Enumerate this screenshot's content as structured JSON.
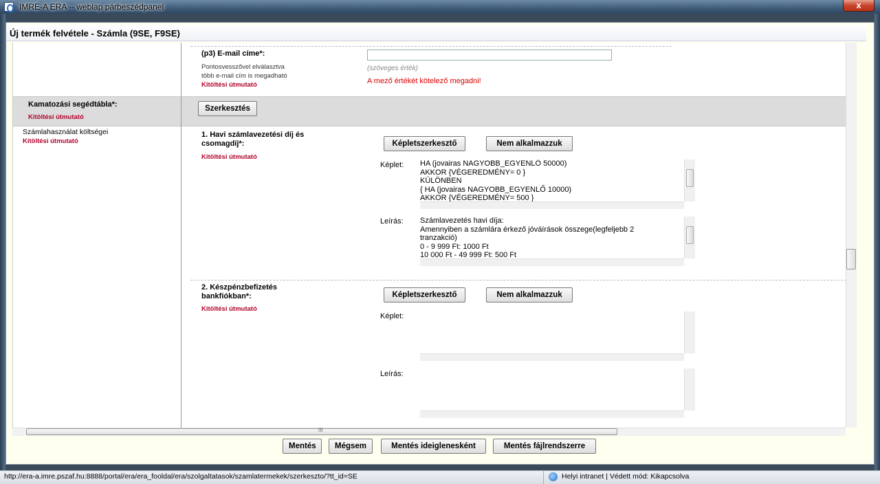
{
  "window": {
    "title": "IMRE-A ERA -- weblap párbeszédpanel",
    "close_glyph": "x"
  },
  "dialog": {
    "title": "Új termék felvétele - Számla (9SE, F9SE)"
  },
  "email_section": {
    "label": "(p3) E-mail címe*:",
    "note_line1": "Pontosvesszővel elválasztva",
    "note_line2": "több e-mail cím is megadható",
    "guide_link": "Kitöltési útmutató",
    "input_value": "",
    "value_hint": "(szöveges érték)",
    "error": "A mező értékét kötelező megadni!"
  },
  "interest_section": {
    "label": "Kamatozási segédtábla*:",
    "guide_link": "Kitöltési útmutató",
    "edit_button": "Szerkesztés"
  },
  "usage_section": {
    "label": "Számlahasználat költségei",
    "guide_link": "Kitöltési útmutató",
    "fees": [
      {
        "title_line1": "1. Havi számlavezetési díj és",
        "title_line2": "csomagdíj*:",
        "guide_link": "Kitöltési útmutató",
        "formula_editor_button": "Képletszerkesztő",
        "not_applied_button": "Nem alkalmazzuk",
        "formula_label": "Képlet:",
        "formula_text": "HA (jovairas NAGYOBB_EGYENLŐ 50000)\nAKKOR {VÉGEREDMÉNY= 0 }\nKÜLÖNBEN\n{ HA (jovairas NAGYOBB_EGYENLŐ 10000)\nAKKOR {VÉGEREDMÉNY= 500 }",
        "description_label": "Leírás:",
        "description_text": "Számlavezetés havi díja:\nAmennyiben a számlára érkező jóváírások összege(legfeljebb 2\ntranzakció)\n0 - 9 999 Ft: 1000 Ft\n10 000 Ft - 49 999 Ft: 500 Ft"
      },
      {
        "title_line1": "2. Készpénzbefizetés",
        "title_line2": "bankfiókban*:",
        "guide_link": "Kitöltési útmutató",
        "formula_editor_button": "Képletszerkesztő",
        "not_applied_button": "Nem alkalmazzuk",
        "formula_label": "Képlet:",
        "formula_text": "",
        "description_label": "Leírás:",
        "description_text": ""
      }
    ]
  },
  "footer": {
    "save": "Mentés",
    "cancel": "Mégsem",
    "save_temp": "Mentés ideiglenesként",
    "save_fs": "Mentés fájlrendszerre"
  },
  "statusbar": {
    "url": "http://era-a.imre.pszaf.hu:8888/portal/era/era_fooldal/era/szolgaltatasok/szamlatermekek/szerkeszto/?tt_id=SE",
    "zone": "Helyi intranet | Védett mód: Kikapcsolva"
  },
  "scroll_grip": "III",
  "colors": {
    "error": "#dd0000",
    "guide": "#b0002a",
    "section_bg": "#dcdcdc"
  }
}
